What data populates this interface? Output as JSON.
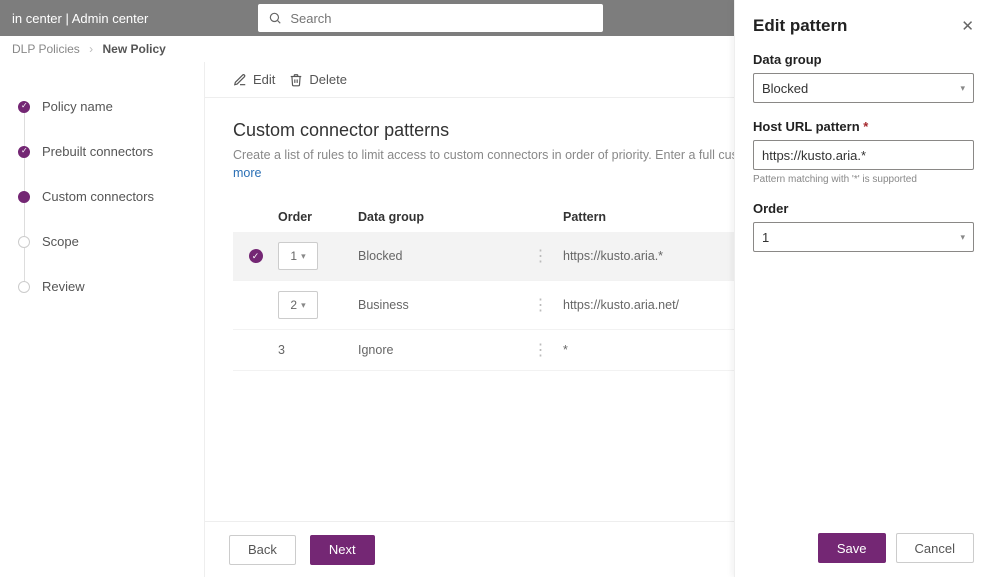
{
  "topbar": {
    "title": "in center  |  Admin center",
    "search_placeholder": "Search"
  },
  "breadcrumb": {
    "root": "DLP Policies",
    "current": "New Policy"
  },
  "steps": [
    {
      "label": "Policy name",
      "state": "done"
    },
    {
      "label": "Prebuilt connectors",
      "state": "done"
    },
    {
      "label": "Custom connectors",
      "state": "current"
    },
    {
      "label": "Scope",
      "state": ""
    },
    {
      "label": "Review",
      "state": ""
    }
  ],
  "toolbar": {
    "edit": "Edit",
    "delete": "Delete"
  },
  "section": {
    "title": "Custom connector patterns",
    "desc": "Create a list of rules to limit access to custom connectors in order of priority. Enter a full custom connector U",
    "more": "more"
  },
  "table": {
    "headers": {
      "order": "Order",
      "group": "Data group",
      "pattern": "Pattern"
    },
    "rows": [
      {
        "selected": true,
        "order": "1",
        "hasChip": true,
        "group": "Blocked",
        "pattern": "https://kusto.aria.*"
      },
      {
        "selected": false,
        "order": "2",
        "hasChip": true,
        "group": "Business",
        "pattern": "https://kusto.aria.net/"
      },
      {
        "selected": false,
        "order": "3",
        "hasChip": false,
        "group": "Ignore",
        "pattern": "*"
      }
    ]
  },
  "footer": {
    "back": "Back",
    "next": "Next"
  },
  "panel": {
    "title": "Edit pattern",
    "data_group_label": "Data group",
    "data_group_value": "Blocked",
    "url_label": "Host URL pattern",
    "url_value": "https://kusto.aria.*",
    "url_hint": "Pattern matching with '*' is supported",
    "order_label": "Order",
    "order_value": "1",
    "save": "Save",
    "cancel": "Cancel"
  }
}
